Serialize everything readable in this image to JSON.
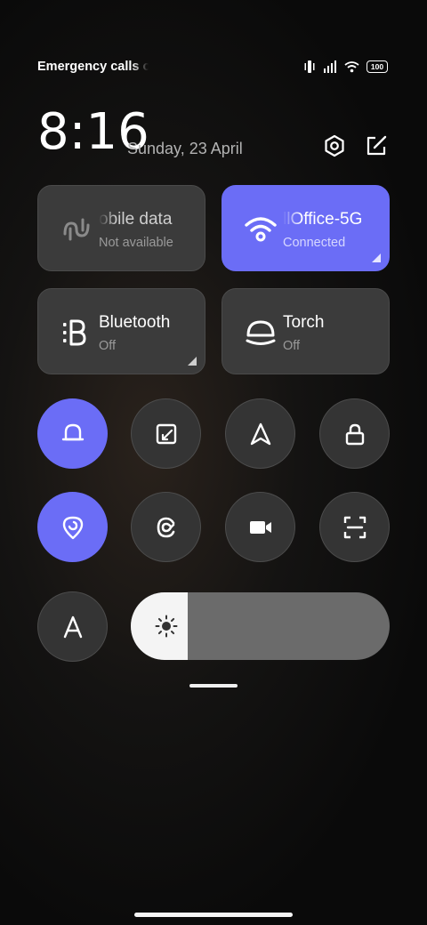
{
  "status_bar": {
    "carrier_text": "Emergency calls o",
    "battery": "100",
    "icons": [
      "vibrate-icon",
      "signal-icon",
      "wifi-icon",
      "battery-icon"
    ]
  },
  "header": {
    "time": "8:16",
    "date": "Sunday, 23 April",
    "icons": [
      "settings-icon",
      "edit-icon"
    ]
  },
  "tiles": [
    {
      "title": "obile data",
      "subtitle": "Not available",
      "active": false,
      "icon": "mobile-data-icon"
    },
    {
      "title": "llOffice-5G",
      "subtitle": "Connected",
      "active": true,
      "icon": "wifi-icon"
    },
    {
      "title": "Bluetooth",
      "subtitle": "Off",
      "active": false,
      "icon": "bluetooth-icon"
    },
    {
      "title": "Torch",
      "subtitle": "Off",
      "active": false,
      "icon": "torch-icon"
    }
  ],
  "toggles": [
    {
      "name": "sound",
      "icon": "bell-icon",
      "active": true
    },
    {
      "name": "screen-rotation",
      "icon": "rotation-lock-icon",
      "active": false
    },
    {
      "name": "airplane",
      "icon": "navigation-arrow-icon",
      "active": false
    },
    {
      "name": "lock",
      "icon": "lock-icon",
      "active": false
    },
    {
      "name": "location",
      "icon": "location-icon",
      "active": true
    },
    {
      "name": "reading-mode",
      "icon": "reading-mode-icon",
      "active": false
    },
    {
      "name": "screen-recorder",
      "icon": "video-camera-icon",
      "active": false
    },
    {
      "name": "scanner",
      "icon": "scan-icon",
      "active": false
    }
  ],
  "auto_brightness": {
    "label": "A",
    "icon": "auto-brightness-icon"
  },
  "brightness": {
    "level": 0.22
  },
  "colors": {
    "accent": "#6b6df6",
    "tile_bg": "#3b3b3b",
    "button_bg": "#343434"
  }
}
